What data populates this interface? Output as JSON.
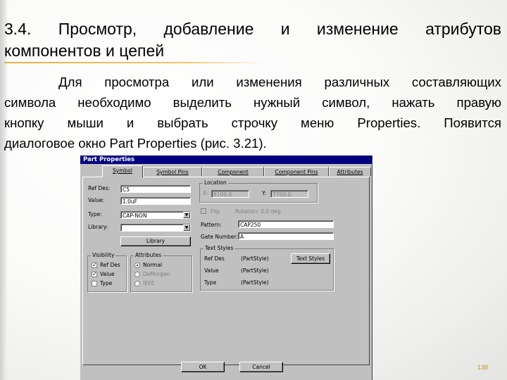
{
  "slide": {
    "heading_line1": [
      "3.4.",
      "Просмотр,",
      "добавление",
      "и",
      "изменение",
      "атрибутов"
    ],
    "heading_line2": "компонентов и цепей",
    "para_lines": [
      [
        "Для",
        "просмотра",
        "или",
        "изменения",
        "различных",
        "составляющих"
      ],
      [
        "символа",
        "необходимо",
        "выделить",
        "нужный",
        "символ,",
        "нажать",
        "правую"
      ],
      [
        "кнопку",
        "мыши",
        "и",
        "выбрать",
        "строчку",
        "меню",
        "Properties.",
        "Появится"
      ]
    ],
    "para_last": "диалоговое окно Part Properties (рис. 3.21).",
    "page_number": "138",
    "accent_color": "#e3b04a"
  },
  "dialog": {
    "title": "Part Properties",
    "tabs": [
      "Symbol",
      "Symbol Pins",
      "Component",
      "Component Pins",
      "Attributes"
    ],
    "ref_des_label": "Ref Des:",
    "ref_des_value": "C5",
    "value_label": "Value:",
    "value_value": "1.0uF",
    "type_label": "Type:",
    "type_value": "CAP-NON",
    "library_label": "Library:",
    "library_value": "",
    "library_btn": "Library",
    "location_title": "Location",
    "x_label": "X:",
    "x_value": "9100.0",
    "y_label": "Y:",
    "y_value": "7700.0",
    "flip_label": "Flip",
    "rotation_label": "Rotation: 0.0 deg",
    "pattern_label": "Pattern:",
    "pattern_value": "CAP250",
    "gate_label": "Gate Number:",
    "gate_value": "A",
    "visibility_title": "Visibility",
    "vis_ref": "Ref Des",
    "vis_value": "Value",
    "vis_type": "Type",
    "attr_title": "Attributes",
    "attr_normal": "Normal",
    "attr_demorgan": "DeMorgan",
    "attr_ieee": "IEEE",
    "textstyles_title": "Text Styles",
    "ts_refdes": "Ref Des",
    "ts_refdes_val": "(PartStyle)",
    "ts_value": "Value",
    "ts_value_val": "(PartStyle)",
    "ts_type": "Type",
    "ts_type_val": "(PartStyle)",
    "text_styles_btn": "Text Styles",
    "ok": "OK",
    "cancel": "Cancel"
  }
}
